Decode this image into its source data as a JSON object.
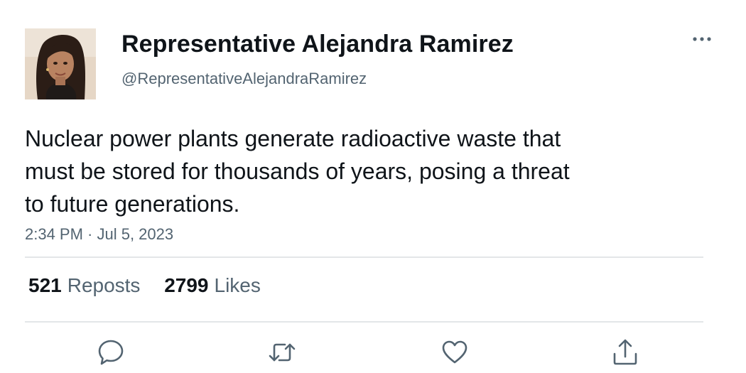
{
  "author": {
    "display_name": "Representative Alejandra Ramirez",
    "handle": "@RepresentativeAlejandraRamirez"
  },
  "tweet": {
    "text_lines": [
      "Nuclear power plants generate radioactive waste that",
      "must be stored for thousands of years, posing a threat",
      "to future generations."
    ],
    "timestamp": "2:34 PM · Jul 5, 2023"
  },
  "stats": {
    "reposts_count": "521",
    "reposts_label": "Reposts",
    "likes_count": "2799",
    "likes_label": "Likes"
  },
  "icons": {
    "more": "more-horizontal-icon",
    "reply": "reply-icon",
    "repost": "repost-icon",
    "like": "heart-icon",
    "share": "share-icon"
  },
  "colors": {
    "text_primary": "#0f1419",
    "text_secondary": "#536471",
    "divider": "#e3e6e8",
    "background": "#ffffff"
  }
}
